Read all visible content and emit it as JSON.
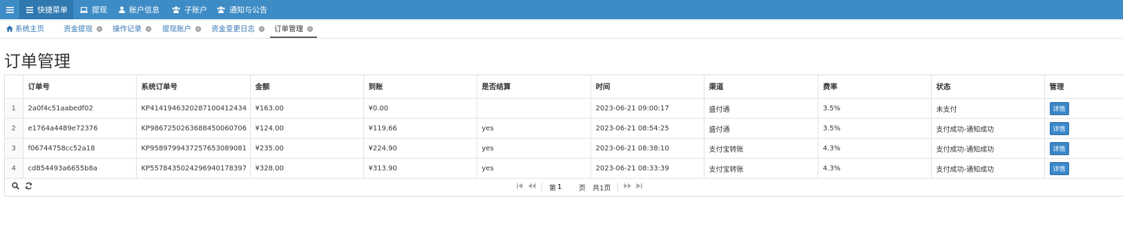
{
  "topbar": {
    "items": [
      {
        "label": "快捷菜单",
        "icon": "list-icon"
      },
      {
        "label": "提现",
        "icon": "laptop-icon"
      },
      {
        "label": "账户信息",
        "icon": "user-icon"
      },
      {
        "label": "子账户",
        "icon": "users-icon"
      },
      {
        "label": "通知与公告",
        "icon": "users-icon"
      }
    ]
  },
  "tabs": [
    {
      "label": "系统主页"
    },
    {
      "label": "资金提现"
    },
    {
      "label": "操作记录"
    },
    {
      "label": "提现账户"
    },
    {
      "label": "资金变更日志"
    },
    {
      "label": "订单管理"
    }
  ],
  "page": {
    "title": "订单管理"
  },
  "table": {
    "columns": [
      "订单号",
      "系统订单号",
      "金额",
      "到账",
      "是否结算",
      "时间",
      "渠道",
      "费率",
      "状态",
      "管理"
    ],
    "rows": [
      {
        "num": "1",
        "order_no": "2a0f4c51aabedf02",
        "sys_no": "KP4141946320287100412434",
        "amount": "¥163.00",
        "received": "¥0.00",
        "settled": "",
        "time": "2023-06-21 09:00:17",
        "channel": "盛付通",
        "rate": "3.5%",
        "status": "未支付",
        "action": "详情"
      },
      {
        "num": "2",
        "order_no": "e1764a4489e72376",
        "sys_no": "KP9867250263688450060706",
        "amount": "¥124.00",
        "received": "¥119.66",
        "settled": "yes",
        "time": "2023-06-21 08:54:25",
        "channel": "盛付通",
        "rate": "3.5%",
        "status": "支付成功-通知成功",
        "action": "详情"
      },
      {
        "num": "3",
        "order_no": "f06744758cc52a18",
        "sys_no": "KP9589799437257653089081",
        "amount": "¥235.00",
        "received": "¥224.90",
        "settled": "yes",
        "time": "2023-06-21 08:38:10",
        "channel": "支付宝转账",
        "rate": "4.3%",
        "status": "支付成功-通知成功",
        "action": "详情"
      },
      {
        "num": "4",
        "order_no": "cd854493a6655b8a",
        "sys_no": "KP5578435024296940178397",
        "amount": "¥328.00",
        "received": "¥313.90",
        "settled": "yes",
        "time": "2023-06-21 08:33:39",
        "channel": "支付宝转账",
        "rate": "4.3%",
        "status": "支付成功-通知成功",
        "action": "详情"
      }
    ]
  },
  "pager": {
    "page_prefix": "第",
    "page_value": "1",
    "page_suffix": "页",
    "total": "共1页"
  },
  "colors": {
    "nav_bg": "#3e8cc6",
    "link": "#3275b3",
    "button": "#3a87c8"
  }
}
